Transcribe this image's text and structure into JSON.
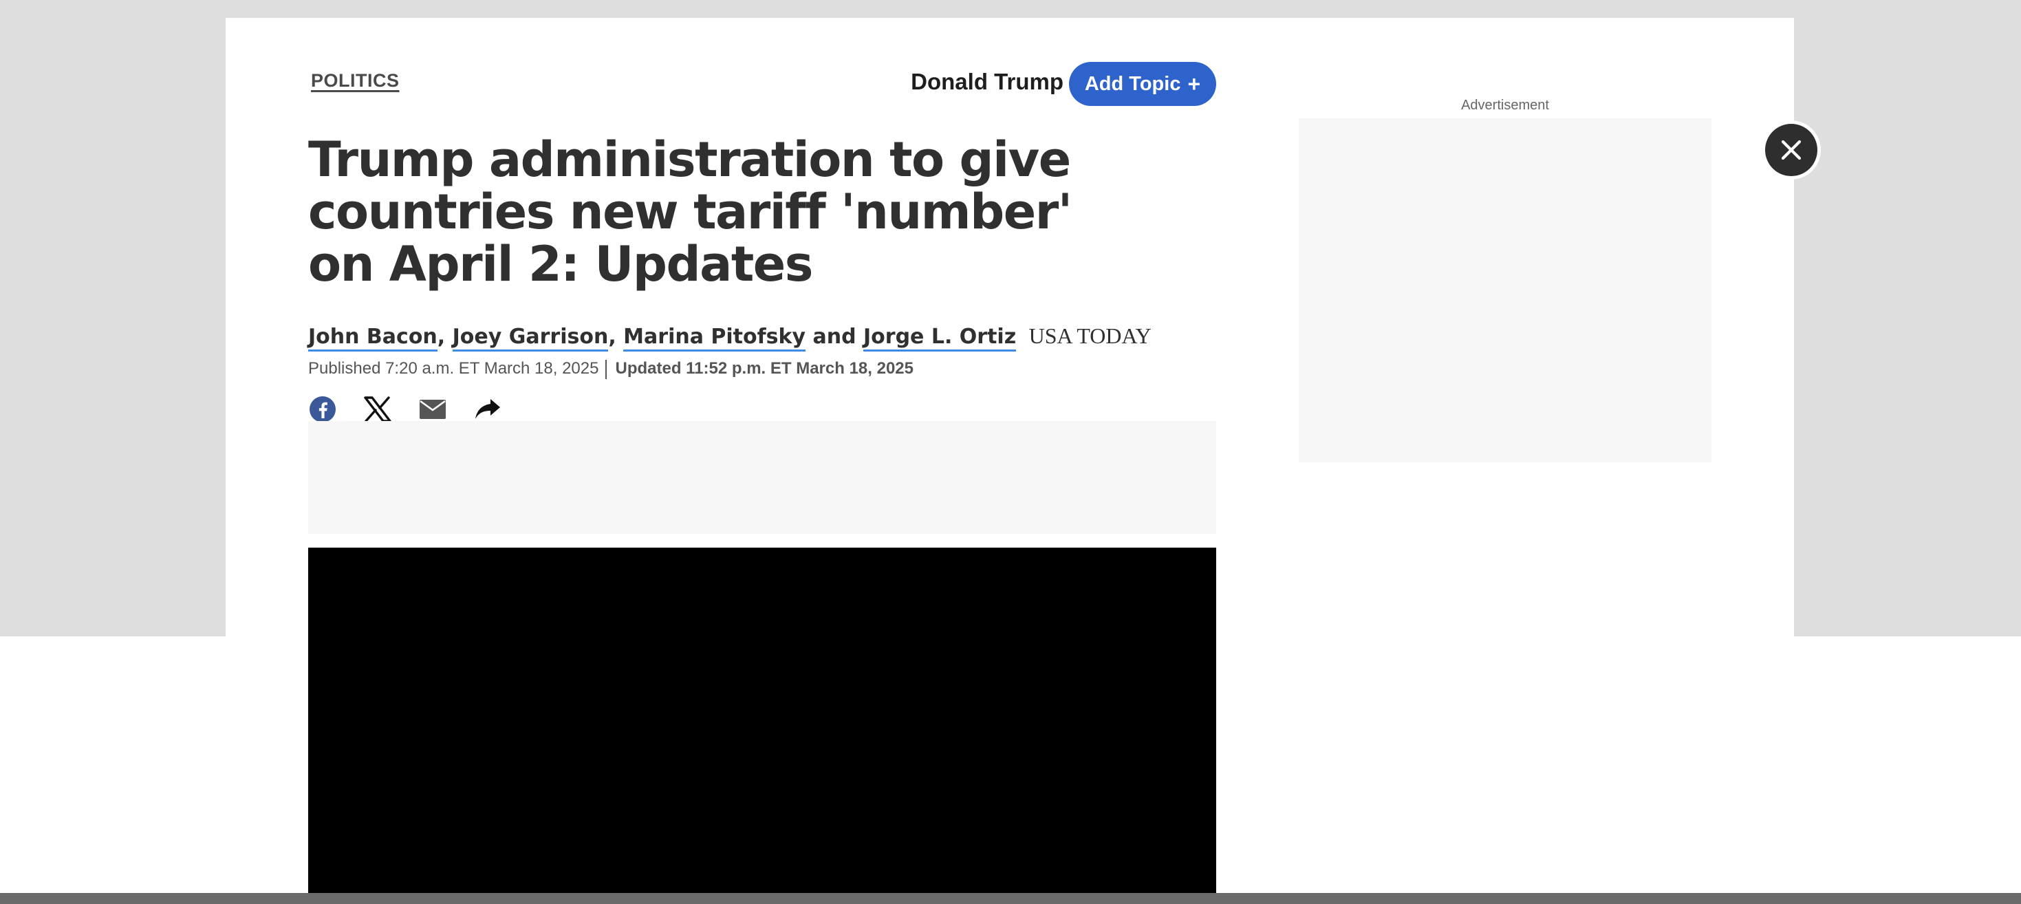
{
  "article": {
    "section": "POLITICS",
    "topic": {
      "name": "Donald Trump",
      "add_label": "Add Topic",
      "add_icon": "+"
    },
    "headline": "Trump administration to give countries new tariff 'number' on April 2: Updates",
    "authors": [
      "John Bacon",
      "Joey Garrison",
      "Marina Pitofsky",
      "Jorge L. Ortiz"
    ],
    "author_separators": [
      ", ",
      ", ",
      " and "
    ],
    "publisher": "USA TODAY",
    "published": "Published 7:20 a.m. ET March 18, 2025",
    "updated": "Updated 11:52 p.m. ET March 18, 2025",
    "share_icons": [
      "facebook-icon",
      "x-icon",
      "email-icon",
      "share-icon"
    ]
  },
  "sidebar": {
    "ad_label": "Advertisement"
  },
  "overlay": {
    "close_icon": "close-icon"
  },
  "colors": {
    "page_gray": "#dedede",
    "accent_blue": "#2f63cc",
    "author_underline": "#3d8be4",
    "text_dark": "#303030",
    "facebook_blue": "#3b5998",
    "video_bg": "#000000"
  }
}
